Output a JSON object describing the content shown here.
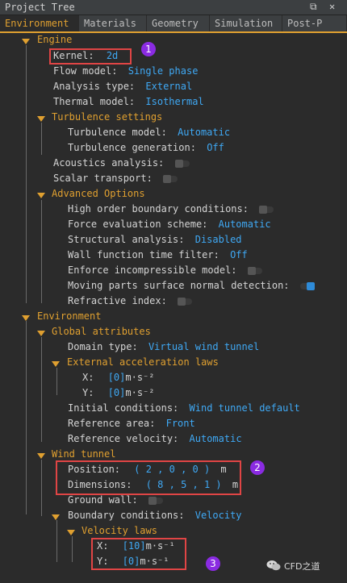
{
  "window": {
    "title": "Project Tree",
    "restore_glyph": "⧉",
    "close_glyph": "✕"
  },
  "tabs": [
    "Environment",
    "Materials",
    "Geometry",
    "Simulation",
    "Post-P"
  ],
  "engine": {
    "header": "Engine",
    "kernel": {
      "label": "Kernel:",
      "value": "2d"
    },
    "flow_model": {
      "label": "Flow model:",
      "value": "Single phase"
    },
    "analysis_type": {
      "label": "Analysis type:",
      "value": "External"
    },
    "thermal_model": {
      "label": "Thermal model:",
      "value": "Isothermal"
    },
    "turbulence": {
      "header": "Turbulence settings",
      "model": {
        "label": "Turbulence model:",
        "value": "Automatic"
      },
      "generation": {
        "label": "Turbulence generation:",
        "value": "Off"
      }
    },
    "acoustics": {
      "label": "Acoustics analysis:",
      "on": false
    },
    "scalar": {
      "label": "Scalar transport:",
      "on": false
    },
    "advanced": {
      "header": "Advanced Options",
      "hobc": {
        "label": "High order boundary conditions:",
        "on": false
      },
      "force": {
        "label": "Force evaluation scheme:",
        "value": "Automatic"
      },
      "structural": {
        "label": "Structural analysis:",
        "value": "Disabled"
      },
      "wall": {
        "label": "Wall function time filter:",
        "value": "Off"
      },
      "incompressible": {
        "label": "Enforce incompressible model:",
        "on": false
      },
      "moving": {
        "label": "Moving parts surface normal detection:",
        "on": true
      },
      "refractive": {
        "label": "Refractive index:",
        "on": false
      }
    }
  },
  "environment": {
    "header": "Environment",
    "global": {
      "header": "Global attributes",
      "domain": {
        "label": "Domain type:",
        "value": "Virtual wind tunnel"
      },
      "ext_acc": {
        "header": "External acceleration laws",
        "x": {
          "label": "X:",
          "value": "[0]",
          "unit": "m·s⁻²"
        },
        "y": {
          "label": "Y:",
          "value": "[0]",
          "unit": "m·s⁻²"
        }
      },
      "initial": {
        "label": "Initial conditions:",
        "value": "Wind tunnel default"
      },
      "ref_area": {
        "label": "Reference area:",
        "value": "Front"
      },
      "ref_vel": {
        "label": "Reference velocity:",
        "value": "Automatic"
      }
    },
    "wind_tunnel": {
      "header": "Wind tunnel",
      "position": {
        "label": "Position:",
        "value": "( 2 , 0 , 0 )",
        "unit": "m"
      },
      "dimensions": {
        "label": "Dimensions:",
        "value": "( 8 , 5 , 1 )",
        "unit": "m"
      },
      "ground": {
        "label": "Ground wall:",
        "on": false
      },
      "boundary": {
        "label": "Boundary conditions:",
        "value": "Velocity"
      },
      "vel_laws": {
        "header": "Velocity laws",
        "x": {
          "label": "X:",
          "value": "[10]",
          "unit": "m·s⁻¹"
        },
        "y": {
          "label": "Y:",
          "value": "[0]",
          "unit": "m·s⁻¹"
        }
      }
    }
  },
  "badges": [
    "1",
    "2",
    "3"
  ],
  "watermark": "CFD之道",
  "colors": {
    "accent": "#e0a030",
    "value": "#3fa9f5",
    "box": "#e04545",
    "badge": "#8a2be2"
  }
}
